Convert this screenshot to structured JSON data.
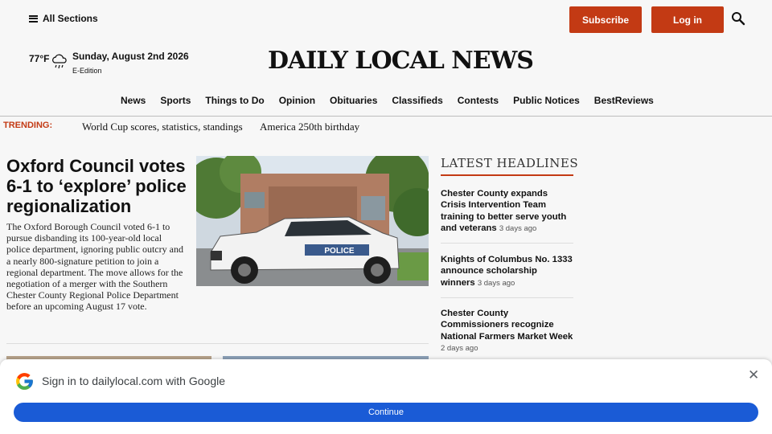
{
  "header": {
    "sections_label": "All Sections",
    "subscribe_label": "Subscribe",
    "login_label": "Log in"
  },
  "weather": {
    "temperature": "77°F",
    "icon": "rain-cloud-icon"
  },
  "date": {
    "text": "Sunday, August 2nd 2026",
    "edition": "E-Edition"
  },
  "masthead": "DAILY LOCAL NEWS",
  "nav": [
    "News",
    "Sports",
    "Things to Do",
    "Opinion",
    "Obituaries",
    "Classifieds",
    "Contests",
    "Public Notices",
    "BestReviews"
  ],
  "trending": {
    "label": "TRENDING:",
    "links": [
      "World Cup scores, statistics, standings",
      "America 250th birthday"
    ]
  },
  "main_story": {
    "headline": "Oxford Council votes 6-1 to ‘explore’ police regionalization",
    "summary": "The Oxford Borough Council voted 6-1 to pursue disbanding its 100-year-old local police department, ignoring public outcry and a nearly 800-signature petition to join a regional department. The move allows for the negotiation of a merger with the Southern Chester County Regional Police Department before an upcoming August 17 vote.",
    "photo_text": "POLICE"
  },
  "latest": {
    "title": "LATEST HEADLINES",
    "items": [
      {
        "title": "Chester County expands Crisis Intervention Team training to better serve youth and veterans",
        "ago": "3 days ago"
      },
      {
        "title": "Knights of Columbus No. 1333 announce scholarship winners",
        "ago": "3 days ago"
      },
      {
        "title": "Chester County Commissioners recognize National Farmers Market Week",
        "ago": "2 days ago"
      }
    ]
  },
  "google_signin": {
    "text": "Sign in to dailylocal.com with Google",
    "button": "Continue"
  },
  "colors": {
    "accent": "#c33a14",
    "google_blue": "#1a5bd6"
  }
}
